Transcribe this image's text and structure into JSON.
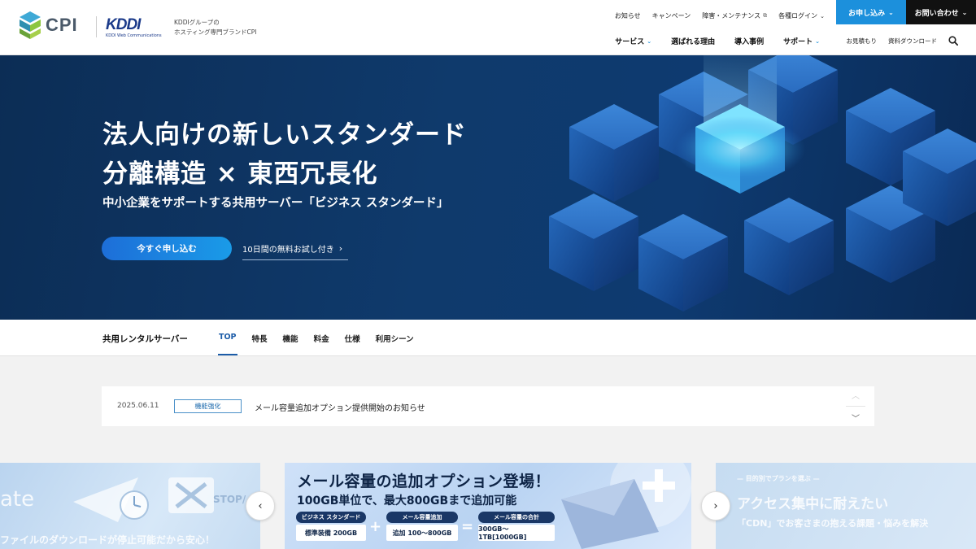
{
  "header": {
    "logo_text": "CPI",
    "kddi_word": "KDDI",
    "kddi_sub": "KDDI Web Communications",
    "tagline_1": "KDDIグループの",
    "tagline_2": "ホスティング専門ブランドCPI",
    "top_links": [
      "お知らせ",
      "キャンペーン",
      "障害・メンテナンス",
      "各種ログイン"
    ],
    "apply_label": "お申し込み",
    "contact_label": "お問い合わせ",
    "main_nav": [
      "サービス",
      "選ばれる理由",
      "導入事例",
      "サポート"
    ],
    "sub_links": [
      "お見積もり",
      "資料ダウンロード"
    ]
  },
  "hero": {
    "title_line1": "法人向けの新しいスタンダード",
    "title_line2": "分離構造 × 東西冗長化",
    "subtitle": "中小企業をサポートする共用サーバー「ビジネス スタンダード」",
    "cta_label": "今すぐ申し込む",
    "trial_label": "10日間の無料お試し付き"
  },
  "tabs": {
    "title": "共用レンタルサーバー",
    "items": [
      "TOP",
      "特長",
      "機能",
      "料金",
      "仕様",
      "利用シーン"
    ],
    "active": "TOP"
  },
  "news": {
    "date": "2025.06.11",
    "badge": "機能強化",
    "title": "メール容量追加オプション提供開始のお知らせ"
  },
  "carousel": {
    "left_ghost_word": "ate",
    "left_caption": "ファイルのダウンロードが停止可能だから安心！",
    "left_stop": "STOP/",
    "center_title": "メール容量の追加オプション登場！",
    "center_sub": "100GB単位で、最大800GBまで追加可能",
    "pill1": "ビジネス スタンダード",
    "pill1_val": "標準装備 200GB",
    "pill2": "メール容量追加",
    "pill2_val": "追加 100〜800GB",
    "pill3": "メール容量の合計",
    "pill3_val": "300GB〜1TB[1000GB]",
    "right_kicker": "— 目的別でプランを選ぶ —",
    "right_title": "アクセス集中に耐えたい",
    "right_caption": "「CDN」でお客さまの抱える課題・悩みを解決"
  },
  "colors": {
    "brand_blue": "#1c90dc",
    "hero_bg": "#0f3a6c",
    "tab_active": "#1c5ca8"
  }
}
